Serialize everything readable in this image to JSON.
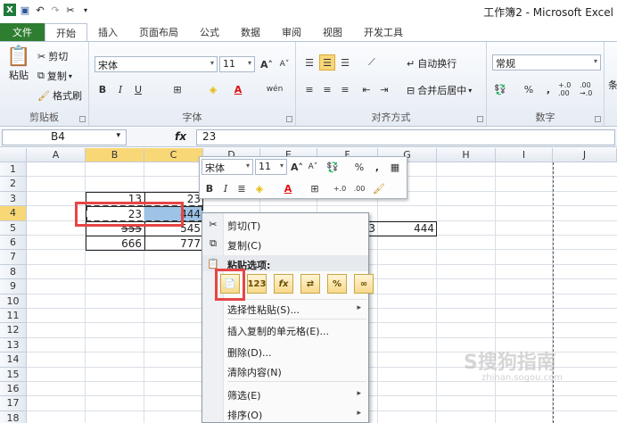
{
  "window": {
    "title": "工作簿2 - Microsoft Excel"
  },
  "tabs": [
    "文件",
    "开始",
    "插入",
    "页面布局",
    "公式",
    "数据",
    "审阅",
    "视图",
    "开发工具"
  ],
  "ribbon": {
    "clipboard": {
      "paste": "粘贴",
      "cut": "剪切",
      "copy": "复制",
      "format_painter": "格式刷",
      "label": "剪贴板"
    },
    "font": {
      "name": "宋体",
      "size": "11",
      "label": "字体",
      "bold": "B",
      "italic": "I",
      "underline": "U",
      "wen": "wén"
    },
    "alignment": {
      "wrap": "自动换行",
      "merge": "合并后居中",
      "label": "对齐方式"
    },
    "number": {
      "format": "常规",
      "percent": "%",
      "comma": ",",
      "inc_dec": "+.0 .00",
      "dec_dec": ".00 →.0",
      "label": "数字"
    },
    "extra": "条"
  },
  "formula_bar": {
    "name_box": "B4",
    "fx": "fx",
    "value": "23"
  },
  "columns": [
    "A",
    "B",
    "C",
    "D",
    "E",
    "F",
    "G",
    "H",
    "I",
    "J"
  ],
  "rows": [
    "1",
    "2",
    "3",
    "4",
    "5",
    "6",
    "7",
    "8",
    "9",
    "10",
    "11",
    "12",
    "13",
    "14",
    "15",
    "16",
    "17",
    "18"
  ],
  "cells": {
    "B3": "13",
    "C3": "23",
    "B4": "23",
    "C4": "444",
    "B5": "555",
    "C5": "545",
    "B6": "666",
    "C6": "777",
    "F5": "3",
    "G5": "444"
  },
  "mini_toolbar": {
    "font": "宋体",
    "size": "11",
    "percent": "%",
    "comma": ","
  },
  "context_menu": {
    "cut": "剪切(T)",
    "copy": "复制(C)",
    "paste_options": "粘贴选项:",
    "paste_buttons": [
      "paste-icon",
      "123",
      "fx",
      "transpose",
      "%",
      "link"
    ],
    "paste_special": "选择性粘贴(S)...",
    "insert_copied": "插入复制的单元格(E)...",
    "delete": "删除(D)...",
    "clear": "清除内容(N)",
    "filter": "筛选(E)",
    "sort": "排序(O)"
  },
  "watermark": {
    "text": "S搜狗指南",
    "url": "zhinan.sogou.com"
  },
  "colors": {
    "file_tab": "#2f7d31",
    "selection": "#f8d777",
    "highlight_cell": "#9dc3e6",
    "red_box": "#e74545"
  }
}
